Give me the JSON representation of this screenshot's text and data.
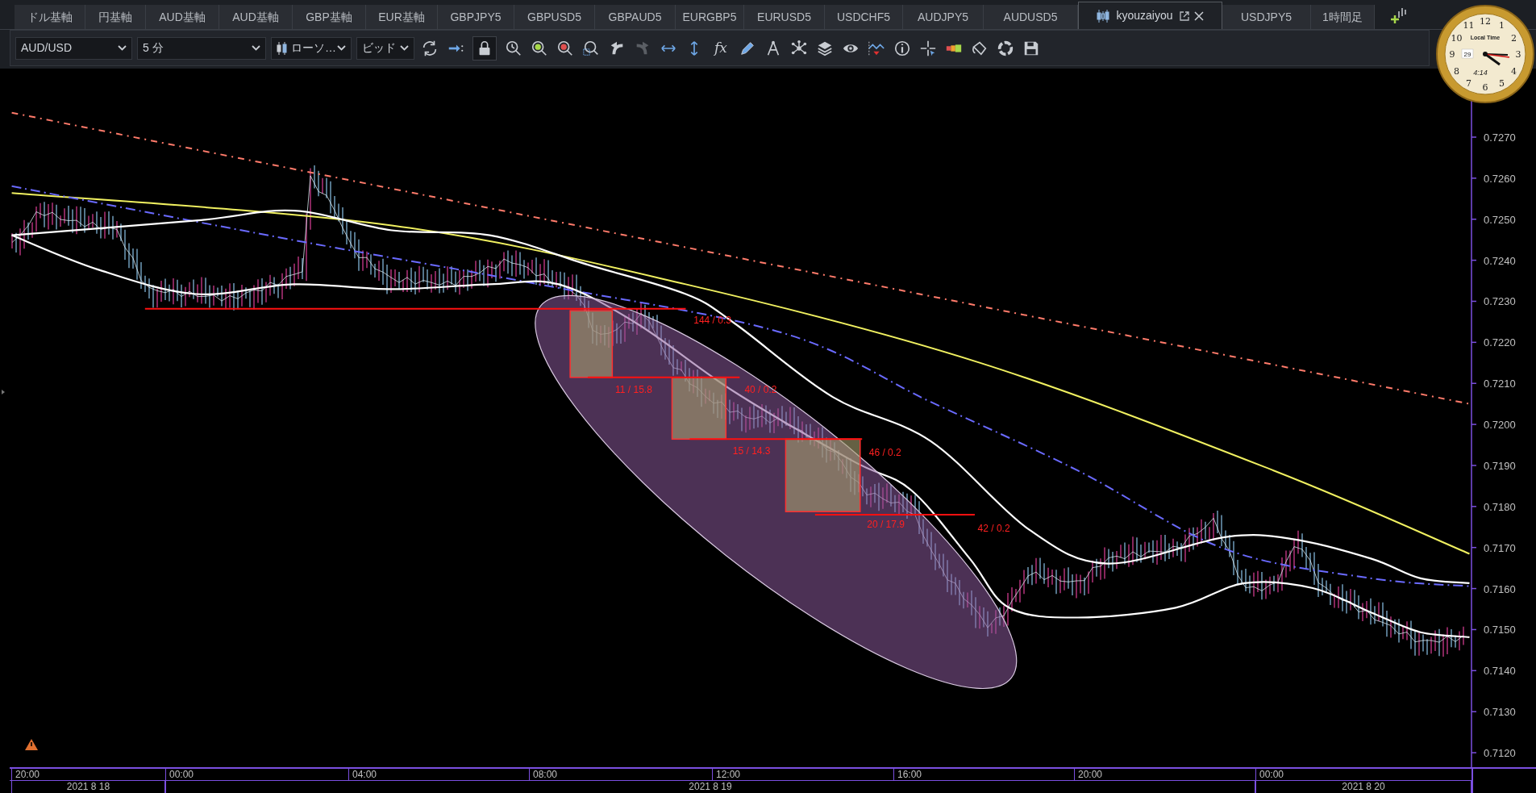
{
  "tabs": [
    {
      "label": "ドル基軸",
      "selected": false
    },
    {
      "label": "円基軸",
      "selected": false
    },
    {
      "label": "AUD基軸",
      "selected": false
    },
    {
      "label": "AUD基軸",
      "selected": false
    },
    {
      "label": "GBP基軸",
      "selected": false
    },
    {
      "label": "EUR基軸",
      "selected": false
    },
    {
      "label": "GBPJPY5",
      "selected": false
    },
    {
      "label": "GBPUSD5",
      "selected": false
    },
    {
      "label": "GBPAUD5",
      "selected": false
    },
    {
      "label": "EURGBP5",
      "selected": false
    },
    {
      "label": "EURUSD5",
      "selected": false
    },
    {
      "label": "USDCHF5",
      "selected": false
    },
    {
      "label": "AUDJPY5",
      "selected": false
    },
    {
      "label": "AUDUSD5",
      "selected": false
    },
    {
      "label": "kyouzaiyou",
      "selected": true
    },
    {
      "label": "USDJPY5",
      "selected": false
    },
    {
      "label": "1時間足",
      "selected": false
    }
  ],
  "toolbar": {
    "symbol": "AUD/USD",
    "timeframe": "5 分",
    "chart_type": "ローソ…",
    "price_type": "ビッド",
    "lock_on": true,
    "formula_button": "fx"
  },
  "clock": {
    "dial_texts": [
      {
        "kind": "numeral",
        "text": "12"
      },
      {
        "kind": "numeral",
        "text": "11"
      },
      {
        "kind": "numeral",
        "text": "1"
      },
      {
        "kind": "numeral",
        "text": "10"
      },
      {
        "kind": "label",
        "text": "Local Time"
      },
      {
        "kind": "numeral",
        "text": "2"
      },
      {
        "kind": "numeral",
        "text": "9"
      },
      {
        "kind": "date",
        "text": "29"
      },
      {
        "kind": "numeral",
        "text": "3"
      },
      {
        "kind": "numeral",
        "text": "8"
      },
      {
        "kind": "time",
        "text": "4:14"
      },
      {
        "kind": "numeral",
        "text": "4"
      },
      {
        "kind": "numeral",
        "text": "7"
      },
      {
        "kind": "numeral",
        "text": "5"
      },
      {
        "kind": "numeral",
        "text": "6"
      }
    ]
  },
  "chart": {
    "price_labels": [
      "0.7270",
      "0.7260",
      "0.7250",
      "0.7240",
      "0.7230",
      "0.7220",
      "0.7210",
      "0.7200",
      "0.7190",
      "0.7180",
      "0.7170",
      "0.7160",
      "0.7150",
      "0.7140",
      "0.7130",
      "0.7120"
    ],
    "annotations": [
      {
        "label": "144 / 0.3"
      },
      {
        "label": "11 / 15.8"
      },
      {
        "label": "40 / 0.2"
      },
      {
        "label": "15 / 14.3"
      },
      {
        "label": "46 / 0.2"
      },
      {
        "label": "20 / 17.9"
      },
      {
        "label": "42 / 0.2"
      }
    ],
    "time_labels": [
      "20:00",
      "00:00",
      "04:00",
      "08:00",
      "12:00",
      "16:00",
      "20:00",
      "00:00"
    ],
    "date_labels": [
      "2021 8 18",
      "2021 8 19",
      "2021 8 20"
    ]
  }
}
